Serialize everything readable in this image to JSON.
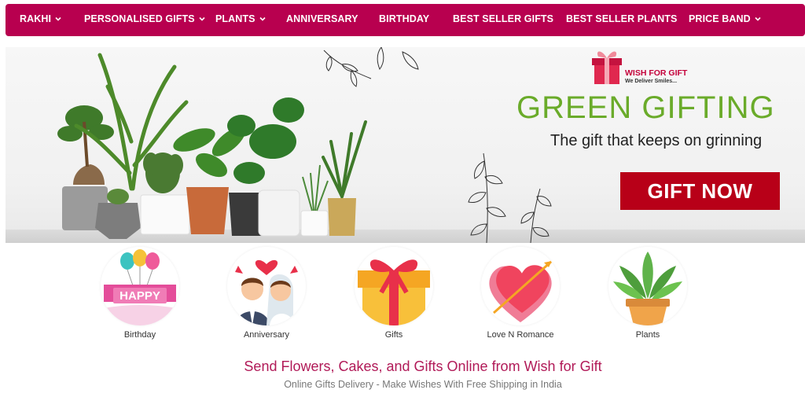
{
  "nav": {
    "items": [
      {
        "label": "RAKHI",
        "has_dropdown": true
      },
      {
        "label": "PERSONALISED GIFTS",
        "has_dropdown": true
      },
      {
        "label": "PLANTS",
        "has_dropdown": true
      },
      {
        "label": "ANNIVERSARY",
        "has_dropdown": false
      },
      {
        "label": "BIRTHDAY",
        "has_dropdown": false
      },
      {
        "label": "BEST SELLER GIFTS",
        "has_dropdown": false
      },
      {
        "label": "BEST SELLER PLANTS",
        "has_dropdown": false
      },
      {
        "label": "PRICE BAND",
        "has_dropdown": true
      }
    ],
    "background": "#b8004f"
  },
  "banner": {
    "logo_title": "WISH FOR GIFT",
    "logo_tagline": "We Deliver Smiles...",
    "headline": "GREEN GIFTING",
    "subline": "The gift that keeps on grinning",
    "cta": "GIFT NOW",
    "headline_color": "#6aab2a",
    "cta_color": "#b80018"
  },
  "categories": [
    {
      "label": "Birthday",
      "icon": "birthday-balloons-icon",
      "art_text": "HAPPY"
    },
    {
      "label": "Anniversary",
      "icon": "couple-icon"
    },
    {
      "label": "Gifts",
      "icon": "gift-box-icon"
    },
    {
      "label": "Love N Romance",
      "icon": "heart-arrow-icon"
    },
    {
      "label": "Plants",
      "icon": "potted-plant-icon"
    }
  ],
  "intro": {
    "title": "Send Flowers, Cakes, and Gifts Online from Wish for Gift",
    "subtitle": "Online Gifts Delivery - Make Wishes With Free Shipping in India"
  }
}
